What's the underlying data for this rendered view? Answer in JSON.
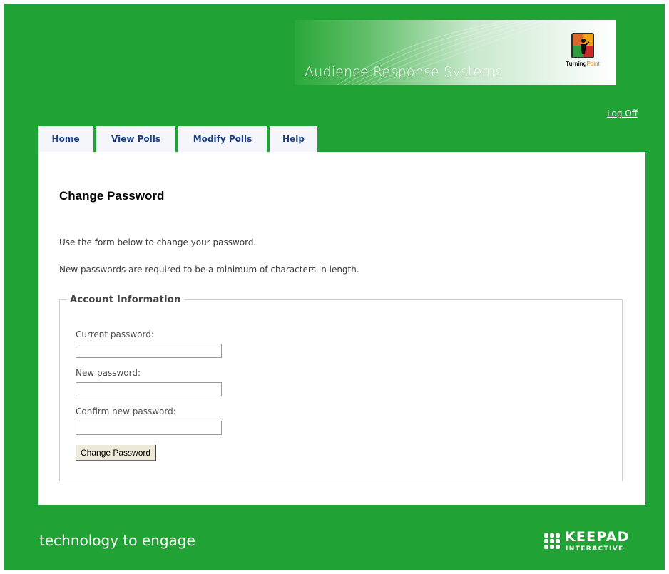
{
  "header": {
    "banner_title": "Audience Response Systems",
    "brand_name_strong": "Turning",
    "brand_name_light": "Point",
    "logoff_label": "Log Off"
  },
  "nav": {
    "tabs": [
      {
        "label": "Home"
      },
      {
        "label": "View Polls"
      },
      {
        "label": "Modify Polls"
      },
      {
        "label": "Help"
      }
    ]
  },
  "main": {
    "title": "Change Password",
    "intro": "Use the form below to change your password.",
    "requirement": "New passwords are required to be a minimum of characters in length.",
    "fieldset_legend": "Account Information",
    "fields": {
      "current_label": "Current password:",
      "current_value": "",
      "new_label": "New password:",
      "new_value": "",
      "confirm_label": "Confirm new password:",
      "confirm_value": ""
    },
    "submit_label": "Change Password"
  },
  "footer": {
    "tagline": "technology to engage",
    "company_name": "KEEPAD",
    "company_sub": "INTERACTIVE"
  },
  "colors": {
    "page_green": "#21a234",
    "tab_text": "#1a3d83",
    "tab_bg": "#f4f6fb"
  }
}
